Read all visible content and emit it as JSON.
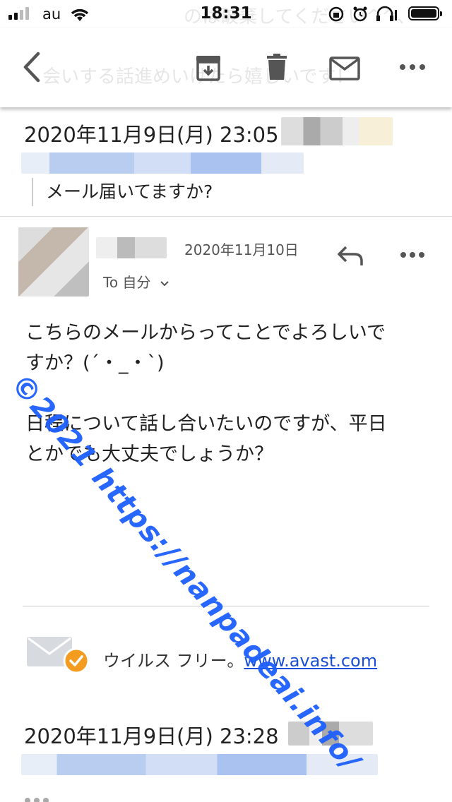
{
  "status_bar": {
    "carrier": "au",
    "time": "18:31"
  },
  "toolbar": {
    "ghost_line1": "のは破棄してください^^、",
    "ghost_line2": "会いする話進めいけたら嬉しいです！"
  },
  "message1": {
    "datetime": "2020年11月9日(月) 23:05",
    "quote": "メール届いてますか?"
  },
  "message2": {
    "date": "2020年11月10日",
    "to_label": "To 自分",
    "body": "こちらのメールからってことでよろしいで\nすか？(´・_・`)\n\n日程について話し合いたいのですが、平日\nとかでも大丈夫でしょうか？",
    "signature_text": "ウイルス フリー。",
    "signature_link": "www.avast.com"
  },
  "message3": {
    "datetime": "2020年11月9日(月) 23:28"
  },
  "watermark": "©2021 https://nanpadeai.info/",
  "colors": {
    "accent_link": "#1a4fd6",
    "watermark": "#1d5fff",
    "check_badge": "#f39c1f"
  }
}
